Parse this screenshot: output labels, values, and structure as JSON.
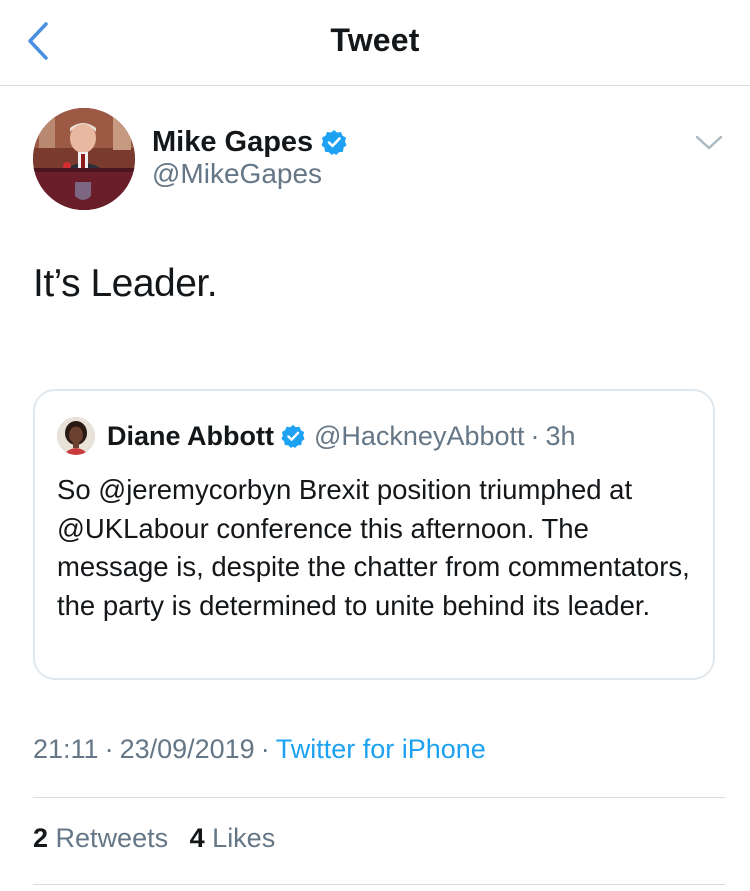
{
  "nav": {
    "title": "Tweet",
    "back_icon": "chevron-left-icon"
  },
  "tweet": {
    "author": {
      "name": "Mike Gapes",
      "handle": "@MikeGapes",
      "verified": true
    },
    "text": "It’s Leader.",
    "quote": {
      "author_name": "Diane Abbott",
      "handle": "@HackneyAbbott",
      "separator": "·",
      "time": "3h",
      "verified": true,
      "text": "So @jeremycorbyn Brexit position triumphed at @UKLabour conference this afternoon. The message is, despite the chatter from commentators, the party is determined to unite behind its leader."
    },
    "meta": {
      "time": "21:11",
      "date": "23/09/2019",
      "separator": "·",
      "source": "Twitter for iPhone"
    },
    "stats": {
      "retweets_count": "2",
      "retweets_label": "Retweets",
      "likes_count": "4",
      "likes_label": "Likes"
    }
  },
  "colors": {
    "accent": "#1da1f2",
    "text_primary": "#14171a",
    "text_secondary": "#657786",
    "border": "#e1e8ed",
    "back_chevron": "#4a90e2"
  }
}
